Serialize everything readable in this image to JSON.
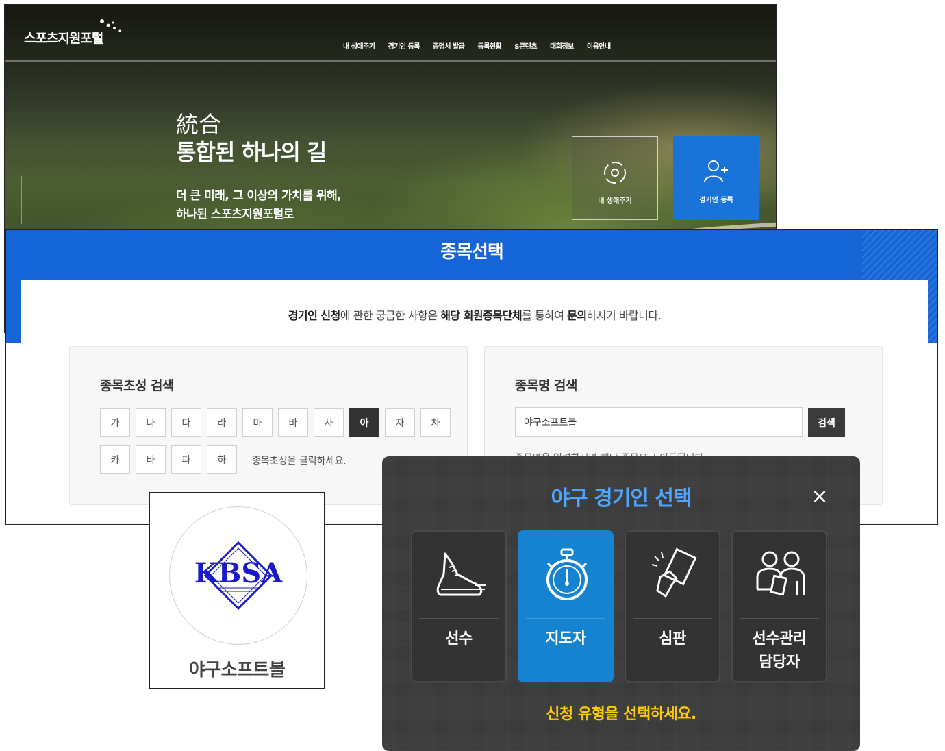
{
  "header": {
    "logo": "스포츠지원포털",
    "nav": [
      "내 생애주기",
      "경기인 등록",
      "증명서 발급",
      "등록현황",
      "S콘텐츠",
      "대회정보",
      "이용안내"
    ]
  },
  "hero": {
    "subtitle": "統合",
    "title": "통합된 하나의 길",
    "desc": [
      "더 큰 미래, 그 이상의 가치를 위해,",
      "하나된 스포츠지원포털로"
    ],
    "quick_buttons": [
      {
        "label": "내 생애주기",
        "icon": "lifecycle-icon"
      },
      {
        "label": "경기인 등록",
        "icon": "add-user-icon"
      }
    ]
  },
  "sport_select": {
    "title": "종목선택",
    "notice": {
      "p1": "경기인 신청",
      "p2": "에 관한 궁금한 사항은 ",
      "p3": "해당 회원종목단체",
      "p4": "를 통하여 ",
      "p5": "문의",
      "p6": "하시기 바랍니다."
    },
    "initial_search": {
      "title": "종목초성 검색",
      "initials": [
        "가",
        "나",
        "다",
        "라",
        "마",
        "바",
        "사",
        "아",
        "자",
        "차",
        "카",
        "타",
        "파",
        "하"
      ],
      "selected": "아",
      "hint": "종목초성을 클릭하세요."
    },
    "name_search": {
      "title": "종목명 검색",
      "value": "야구소프트볼",
      "button": "검색",
      "hint": "종목명을 입력하시면 해당 종목으로 이동됩니다."
    }
  },
  "association": {
    "logo_text": "KBSA",
    "name": "야구소프트볼"
  },
  "modal": {
    "title": "야구 경기인 선택",
    "close_label": "×",
    "options": [
      {
        "label": "선수",
        "icon": "running-shoe-icon"
      },
      {
        "label": "지도자",
        "icon": "stopwatch-icon"
      },
      {
        "label": "심판",
        "icon": "referee-card-icon"
      },
      {
        "label": "선수관리",
        "label2": "담당자",
        "icon": "manager-icon"
      }
    ],
    "selected": "지도자",
    "hint": "신청 유형을 선택하세요."
  },
  "colors": {
    "brand_blue": "#1565d8",
    "modal_title": "#4fa6ff",
    "modal_hint": "#ffcc00",
    "selected_option": "#1583d0"
  }
}
